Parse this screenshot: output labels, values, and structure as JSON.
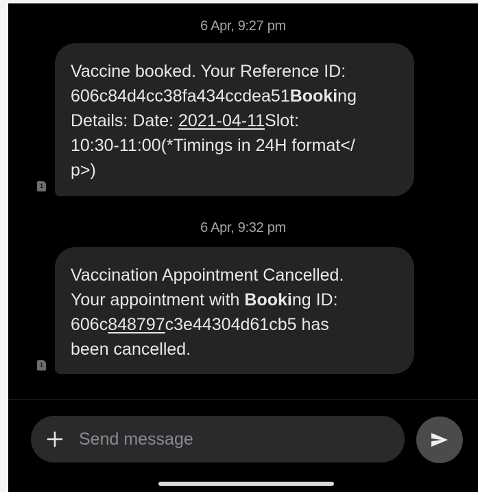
{
  "conversation": {
    "messages": [
      {
        "timestamp": "6 Apr, 9:27 pm",
        "lines": [
          [
            {
              "t": "Vaccine booked. Your Reference ID:"
            }
          ],
          [
            {
              "t": "606c84d4cc38fa434ccdea51"
            },
            {
              "t": "Booki",
              "style": "bold"
            },
            {
              "t": "ng"
            }
          ],
          [
            {
              "t": "Details: Date: "
            },
            {
              "t": "2021-04-11",
              "style": "underline"
            },
            {
              "t": "Slot:"
            }
          ],
          [
            {
              "t": "10:30-11:00(*Timings in 24H format</"
            }
          ],
          [
            {
              "t": "p>)"
            }
          ]
        ],
        "sim_badge": "1"
      },
      {
        "timestamp": "6 Apr, 9:32 pm",
        "lines": [
          [
            {
              "t": "Vaccination Appointment Cancelled."
            }
          ],
          [
            {
              "t": "Your appointment with "
            },
            {
              "t": "Booki",
              "style": "bold"
            },
            {
              "t": "ng ID:"
            }
          ],
          [
            {
              "t": "606c"
            },
            {
              "t": "848797",
              "style": "underline"
            },
            {
              "t": "c3e44304d61cb5 has"
            }
          ],
          [
            {
              "t": "been cancelled."
            }
          ]
        ],
        "sim_badge": "1"
      }
    ]
  },
  "composer": {
    "placeholder": "Send message",
    "value": "",
    "add_icon": "plus-icon",
    "send_icon": "send-arrow-icon"
  },
  "colors": {
    "background": "#000000",
    "bubble": "#242426",
    "send_button": "#4b4b4e"
  }
}
